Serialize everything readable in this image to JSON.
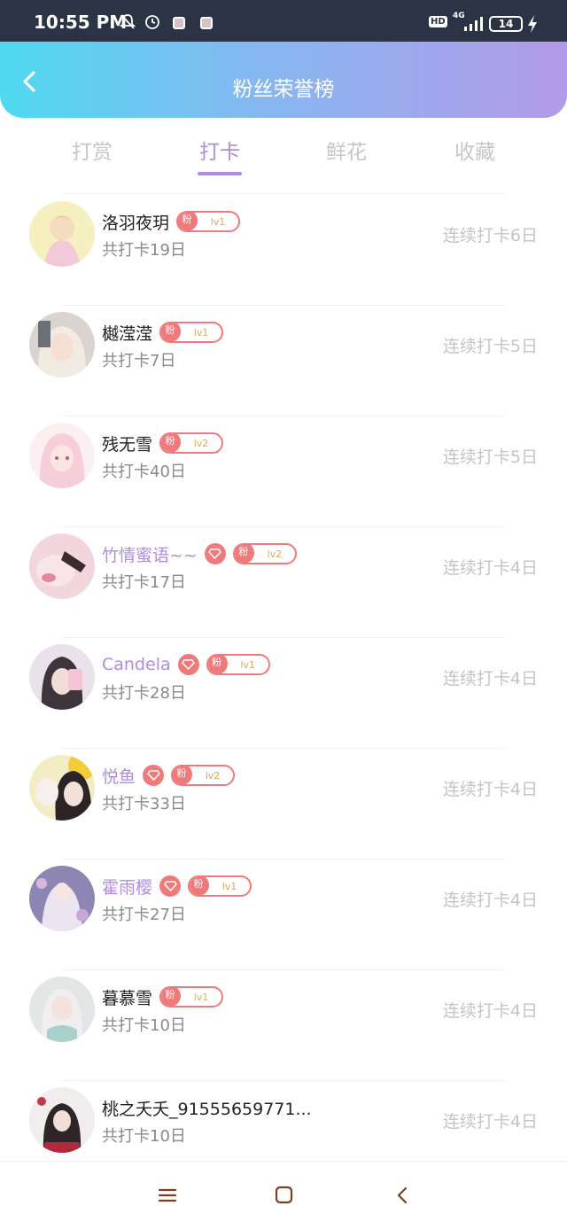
{
  "status_bar": {
    "time": "10:55 PM",
    "network": "4G",
    "battery": "14",
    "hd": "HD"
  },
  "header": {
    "title": "粉丝荣誉榜",
    "back_icon": "chevron-left-icon"
  },
  "tabs": [
    {
      "label": "打赏",
      "active": false
    },
    {
      "label": "打卡",
      "active": true
    },
    {
      "label": "鲜花",
      "active": false
    },
    {
      "label": "收藏",
      "active": false
    }
  ],
  "fan_badge_label": "粉",
  "colors": {
    "accent": "#b08bde",
    "badge": "#ef7a7c",
    "header_start": "#4fd9f0",
    "header_end": "#b39ae9"
  },
  "fans": [
    {
      "name": "洛羽夜玥",
      "vip": false,
      "level": "lv1",
      "total": "共打卡19日",
      "streak": "连续打卡6日"
    },
    {
      "name": "樾滢滢",
      "vip": false,
      "level": "lv1",
      "total": "共打卡7日",
      "streak": "连续打卡5日"
    },
    {
      "name": "残无雪",
      "vip": false,
      "level": "lv2",
      "total": "共打卡40日",
      "streak": "连续打卡5日"
    },
    {
      "name": "竹情蜜语~~",
      "vip": true,
      "level": "lv2",
      "total": "共打卡17日",
      "streak": "连续打卡4日"
    },
    {
      "name": "Candela",
      "vip": true,
      "level": "lv1",
      "total": "共打卡28日",
      "streak": "连续打卡4日"
    },
    {
      "name": "悦鱼",
      "vip": true,
      "level": "lv2",
      "total": "共打卡33日",
      "streak": "连续打卡4日"
    },
    {
      "name": "霍雨樱",
      "vip": true,
      "level": "lv1",
      "total": "共打卡27日",
      "streak": "连续打卡4日"
    },
    {
      "name": "暮慕雪",
      "vip": false,
      "level": "lv1",
      "total": "共打卡10日",
      "streak": "连续打卡4日"
    },
    {
      "name": "桃之夭夭_91555659771...",
      "vip": false,
      "level": "",
      "total": "共打卡10日",
      "streak": "连续打卡4日"
    }
  ],
  "nav": [
    "menu-icon",
    "home-icon",
    "back-icon"
  ]
}
